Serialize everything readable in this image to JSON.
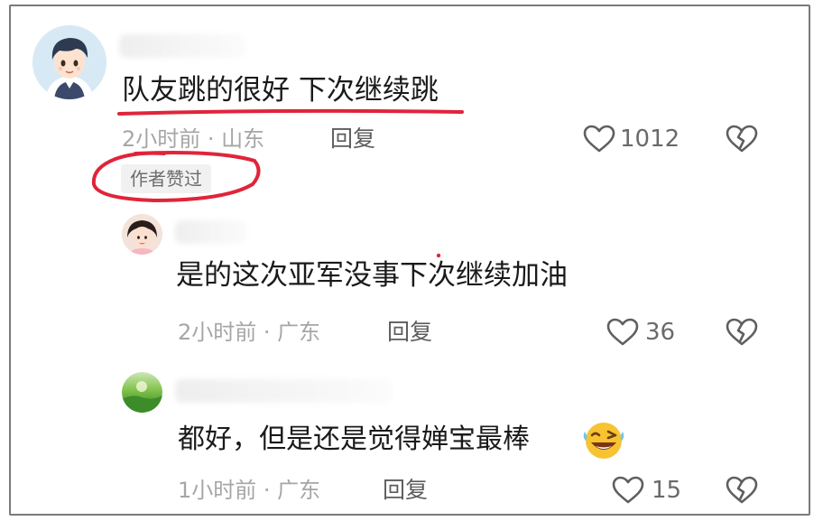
{
  "comments": [
    {
      "text": "队友跳的很好 下次继续跳",
      "time_location": "2小时前 · 山东",
      "reply_label": "回复",
      "likes": "1012",
      "badge": "作者赞过"
    },
    {
      "text": "是的这次亚军没事下次继续加油",
      "time_location": "2小时前 · 广东",
      "reply_label": "回复",
      "likes": "36"
    },
    {
      "text": "都好，但是还是觉得婵宝最棒",
      "time_location": "1小时前 · 广东",
      "reply_label": "回复",
      "likes": "15",
      "emoji": "laughing-wink-emoji"
    }
  ],
  "colors": {
    "annotation_red": "#e0243a",
    "meta_gray": "#a6a6a6",
    "icon_gray": "#5f5f5f"
  }
}
